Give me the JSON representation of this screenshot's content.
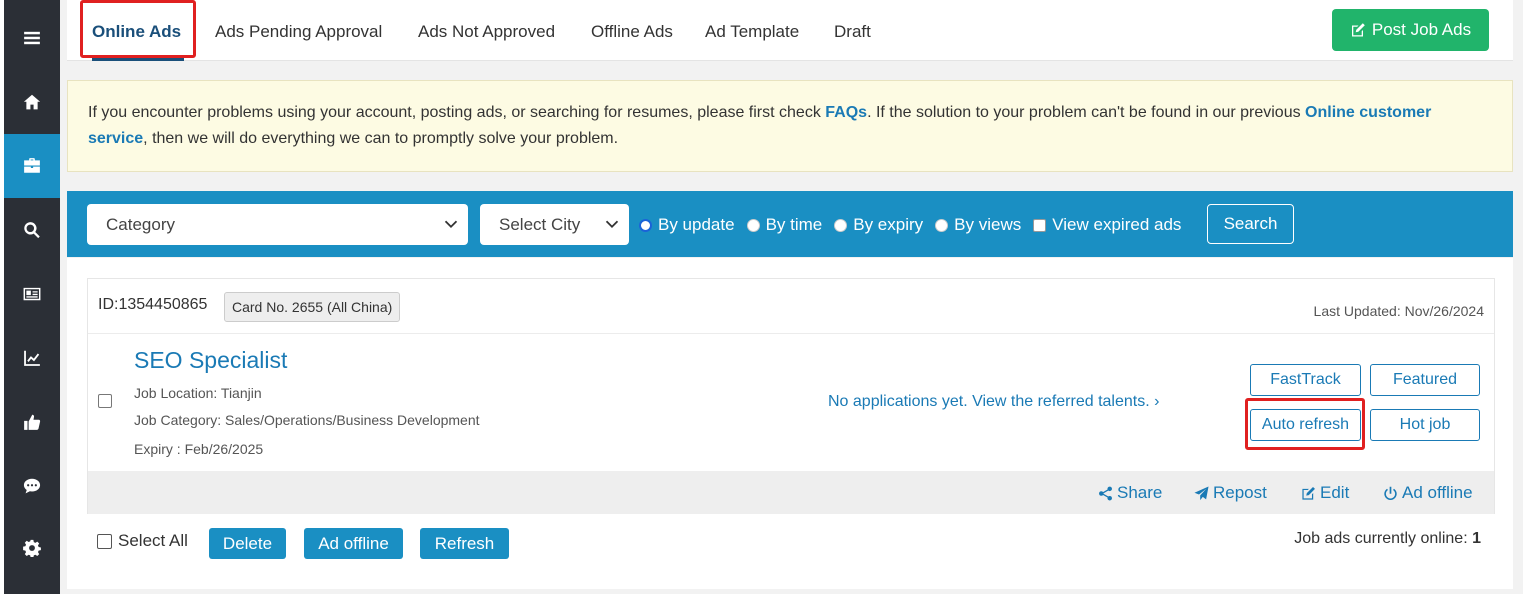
{
  "sidebar": {
    "items": [
      {
        "icon": "menu-icon"
      },
      {
        "icon": "home-icon"
      },
      {
        "icon": "briefcase-icon",
        "active": true
      },
      {
        "icon": "search-icon"
      },
      {
        "icon": "id-card-icon"
      },
      {
        "icon": "chart-line-icon"
      },
      {
        "icon": "thumbs-up-icon"
      },
      {
        "icon": "chat-icon"
      },
      {
        "icon": "gear-icon"
      }
    ]
  },
  "tabs": [
    "Online Ads",
    "Ads Pending Approval",
    "Ads Not Approved",
    "Offline Ads",
    "Ad Template",
    "Draft"
  ],
  "post_button": "Post Job Ads",
  "notice": {
    "text1": "If you encounter problems using your account, posting ads, or searching for resumes, please first check ",
    "faq": "FAQs",
    "text2": ". If the solution to your problem can't be found in our previous ",
    "service": "Online customer service",
    "text3": ", then we will do everything we can to promptly solve your problem."
  },
  "filter": {
    "category": "Category",
    "city": "Select City",
    "sort_options": [
      "By update",
      "By time",
      "By expiry",
      "By views"
    ],
    "selected_sort": "By update",
    "expired_label": "View expired ads",
    "search": "Search"
  },
  "job": {
    "id": "ID:1354450865",
    "card": "Card No. 2655 (All China)",
    "updated": "Last Updated: Nov/26/2024",
    "title": "SEO Specialist",
    "location": "Job Location: Tianjin",
    "category": "Job Category: Sales/Operations/Business Development",
    "expiry": "Expiry : Feb/26/2025",
    "applications": "No applications yet. View the referred talents. ›",
    "actions": [
      "FastTrack",
      "Featured",
      "Auto refresh",
      "Hot job"
    ],
    "footer_links": [
      "Share",
      "Repost",
      "Edit",
      "Ad offline"
    ]
  },
  "bulk": {
    "select_all": "Select All",
    "delete": "Delete",
    "offline": "Ad offline",
    "refresh": "Refresh",
    "online_label": "Job ads currently online: ",
    "online_count": "1"
  },
  "colors": {
    "sidebar": "#2b2f36",
    "accent": "#1a8fc3",
    "link": "#1a7ab5",
    "success": "#21b46b",
    "highlight": "#e02020"
  }
}
